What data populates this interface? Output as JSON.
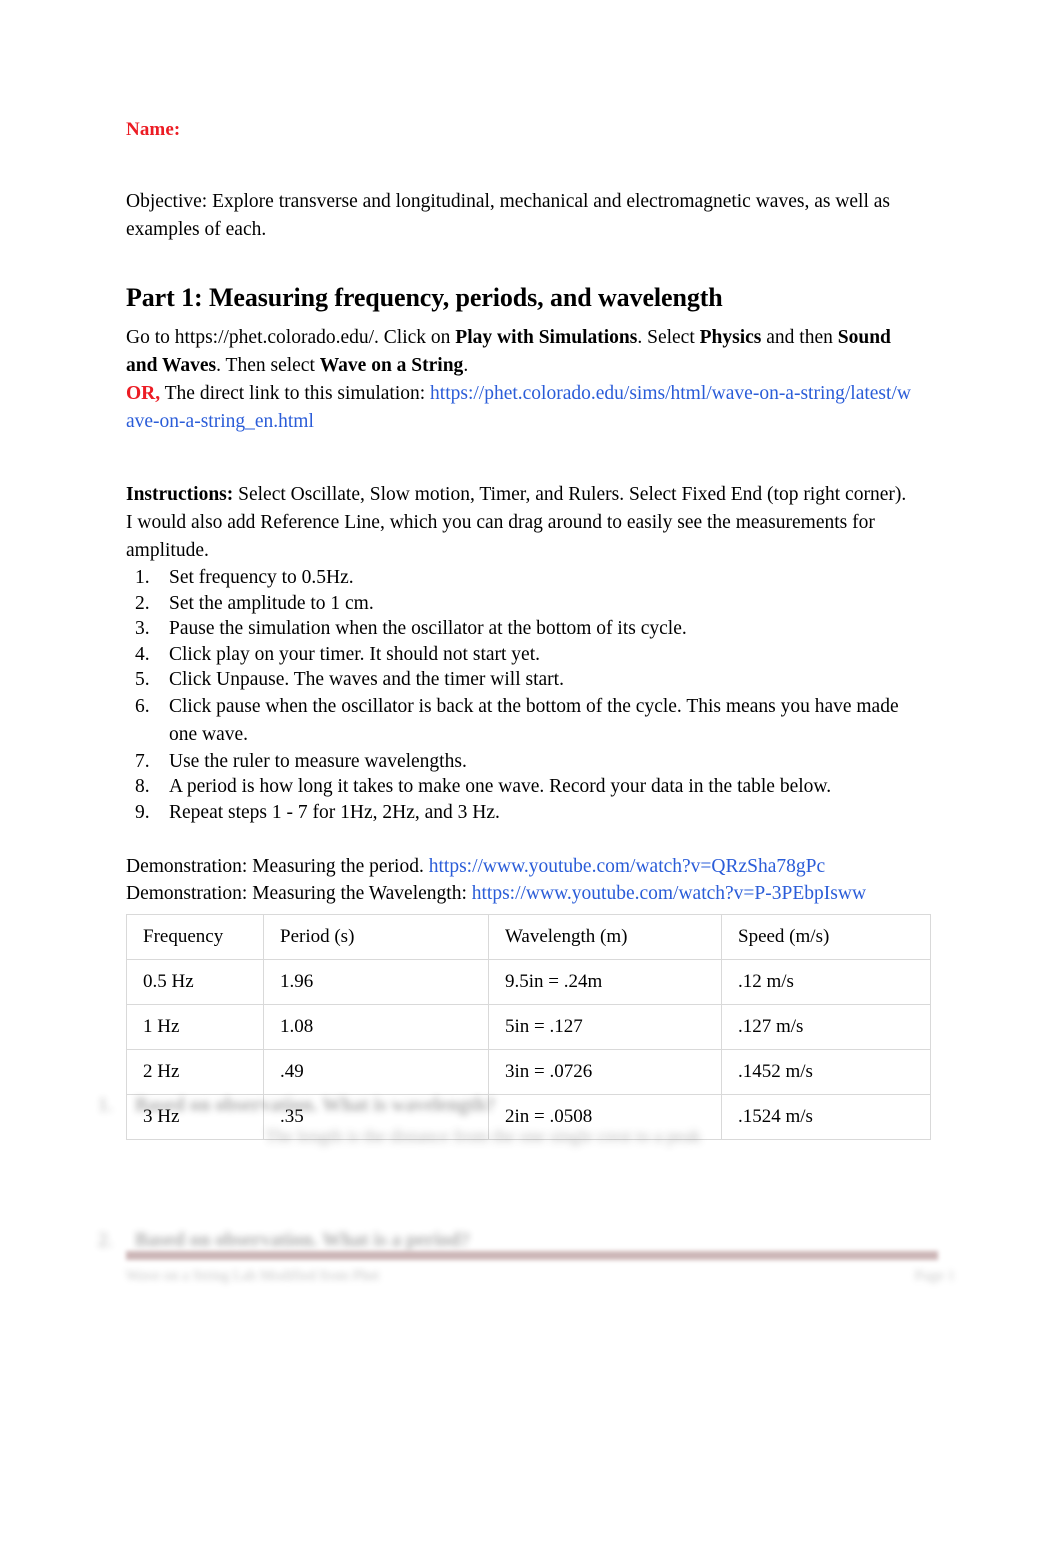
{
  "document": {
    "name_label": "Name:",
    "objective": "Objective: Explore transverse and longitudinal, mechanical and electromagnetic waves, as well as examples of each.",
    "part_heading": "Part 1: Measuring frequency, periods, and wavelength",
    "intro": {
      "line1_a": "Go to https://phet.colorado.edu/. Click on ",
      "line1_b": "Play with Simulations",
      "line1_c": ". Select ",
      "line1_d": "Physics",
      "line1_e": " and then ",
      "line2_a": "Sound and Waves",
      "line2_b": ". Then select ",
      "line2_c": "Wave on a String",
      "line2_d": ".",
      "or_label": "OR,",
      "or_text": " The direct link to this simulation: ",
      "sim_url": "https://phet.colorado.edu/sims/html/wave-on-a-string/latest/wave-on-a-string_en.html"
    },
    "instructions": {
      "label": "Instructions:",
      "text": " Select Oscillate, Slow motion, Timer, and Rulers. Select Fixed End (top right corner). I would also add Reference Line, which you can drag around to easily see the measurements for amplitude."
    },
    "steps": [
      "Set frequency to 0.5Hz.",
      "Set the amplitude to 1 cm.",
      "Pause the simulation when the oscillator at the bottom of its cycle.",
      "Click play on your timer. It should not start yet.",
      "Click Unpause. The waves and the timer will start.",
      "Click pause when the oscillator is back at the bottom of the cycle. This means you have made one wave.",
      "Use the ruler to measure wavelengths.",
      "A period is how long it takes to make one wave.  Record your data in the table below.",
      "Repeat steps 1 - 7 for 1Hz, 2Hz, and 3 Hz."
    ],
    "demos": {
      "period_label": "Demonstration: Measuring the period. ",
      "period_url": "https://www.youtube.com/watch?v=QRzSha78gPc",
      "wavelength_label": "Demonstration: Measuring the Wavelength: ",
      "wavelength_url": "https://www.youtube.com/watch?v=P-3PEbpIsww"
    },
    "table": {
      "headers": [
        "Frequency",
        "Period (s)",
        "Wavelength (m)",
        "Speed (m/s)"
      ],
      "rows": [
        [
          "0.5 Hz",
          "1.96",
          "9.5in = .24m",
          ".12  m/s"
        ],
        [
          "1 Hz",
          "1.08",
          "5in = .127",
          ".127 m/s"
        ],
        [
          "2 Hz",
          ".49",
          "3in = .0726",
          ".1452 m/s"
        ],
        [
          "3 Hz",
          ".35",
          "2in = .0508",
          ".1524 m/s"
        ]
      ]
    },
    "blurred_questions": [
      {
        "number": "1.",
        "question": "Based on observation. What is wavelength?",
        "answer": "The length is the distance from the one single crest to a peak"
      },
      {
        "number": "2.",
        "question": "Based on observation. What is a period?",
        "answer": ""
      }
    ],
    "footer": {
      "text": "Wave on a String Lab  Modified from  Phet",
      "page": "Page 1"
    },
    "colors": {
      "accent_red": "#ec1c24",
      "link_blue": "#2a5cd8",
      "footer_bar": "#c4a9aa",
      "table_border": "#d9d9d9"
    }
  }
}
